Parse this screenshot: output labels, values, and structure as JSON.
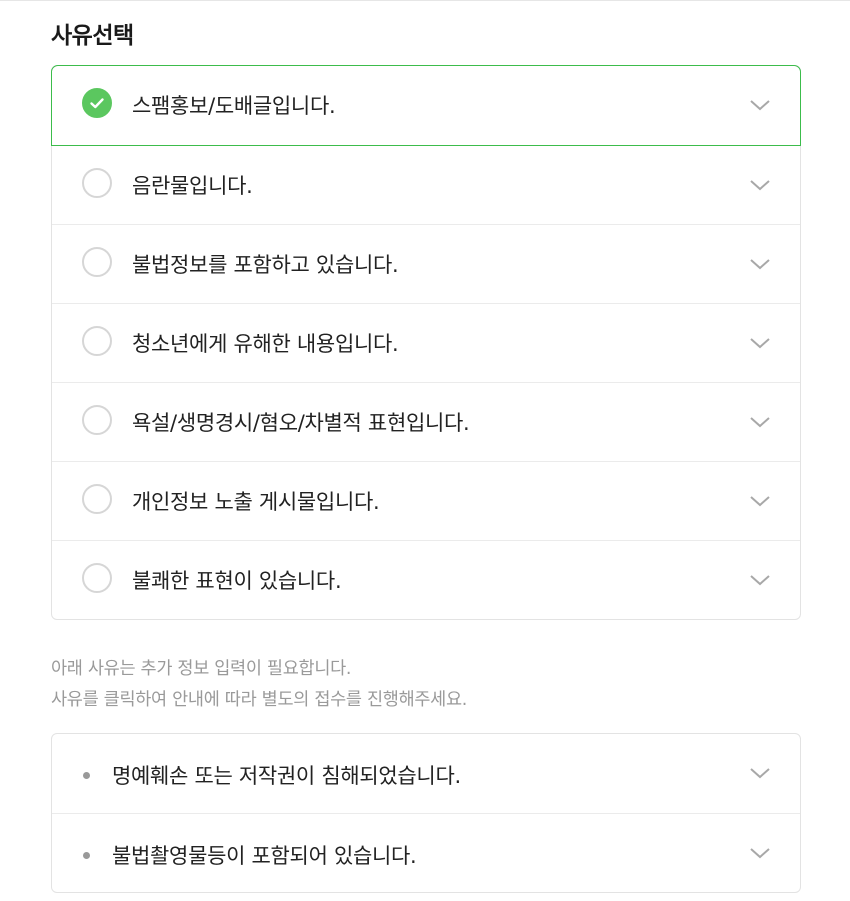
{
  "heading": "사유선택",
  "reasons": [
    {
      "label": "스팸홍보/도배글입니다.",
      "selected": true
    },
    {
      "label": "음란물입니다.",
      "selected": false
    },
    {
      "label": "불법정보를 포함하고 있습니다.",
      "selected": false
    },
    {
      "label": "청소년에게 유해한 내용입니다.",
      "selected": false
    },
    {
      "label": "욕설/생명경시/혐오/차별적 표현입니다.",
      "selected": false
    },
    {
      "label": "개인정보 노출 게시물입니다.",
      "selected": false
    },
    {
      "label": "불쾌한 표현이 있습니다.",
      "selected": false
    }
  ],
  "notice": {
    "line1": "아래 사유는 추가 정보 입력이 필요합니다.",
    "line2": "사유를 클릭하여 안내에 따라 별도의 접수를 진행해주세요."
  },
  "extra_reasons": [
    {
      "label": "명예훼손 또는 저작권이 침해되었습니다."
    },
    {
      "label": "불법촬영물등이 포함되어 있습니다."
    }
  ],
  "icons": {
    "check": "check-icon",
    "chevron": "chevron-down-icon",
    "bullet": "bullet-dot-icon"
  },
  "colors": {
    "accent": "#5bc75f",
    "selected_border": "#3cbc4b",
    "notice_text": "#9a9a9a"
  }
}
